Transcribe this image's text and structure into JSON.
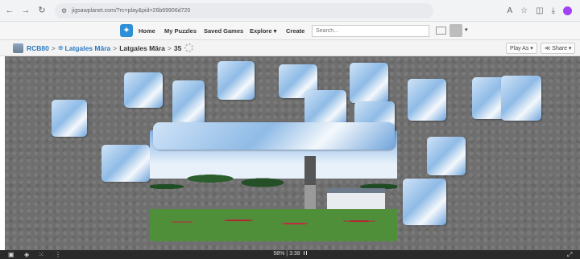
{
  "browser": {
    "url": "jigsawplanet.com/?rc=play&pid=26b69906d720",
    "icons": [
      "back-icon",
      "forward-icon",
      "reload-icon",
      "site-settings-icon",
      "translate-icon",
      "bookmark-star-icon",
      "extensions-icon",
      "download-icon",
      "profile-icon"
    ]
  },
  "nav": {
    "home": "Home",
    "my_puzzles": "My Puzzles",
    "saved_games": "Saved Games",
    "explore": "Explore ▾",
    "create": "Create",
    "search_placeholder": "Search..."
  },
  "breadcrumb": {
    "user": "RCB80",
    "sep1": ">",
    "album": "Latgales Māra",
    "sep2": ">",
    "puzzle": "Latgales Māra",
    "sep3": ">",
    "pieces": "35",
    "play_as": "Play As ▾",
    "share": "Share ▾"
  },
  "status": {
    "progress_percent": 58,
    "progress_label": "58%",
    "separator": "|",
    "timer": "3:38"
  },
  "colors": {
    "link": "#2a7ac0",
    "board": "#6f6f6f",
    "bottom_bar": "#2a2a2a"
  }
}
